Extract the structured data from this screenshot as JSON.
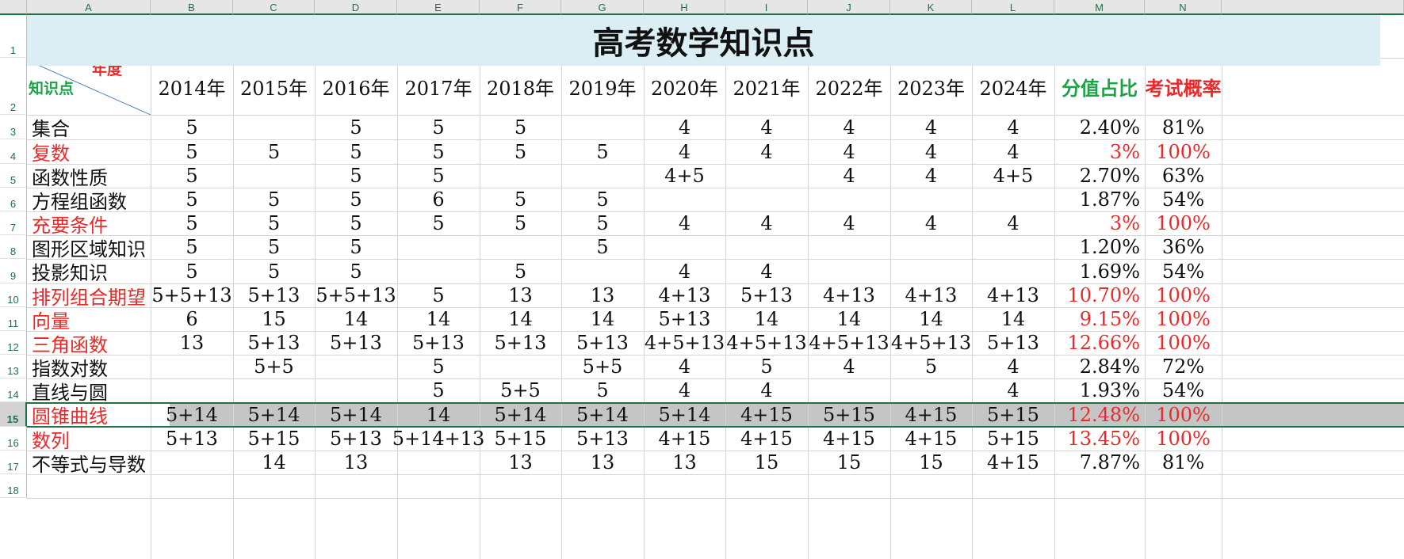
{
  "columns": [
    "A",
    "B",
    "C",
    "D",
    "E",
    "F",
    "G",
    "H",
    "I",
    "J",
    "K",
    "L",
    "M",
    "N"
  ],
  "title": "高考数学知识点",
  "corner": {
    "year_label": "年度",
    "topic_label": "知识点"
  },
  "years": [
    "2014年",
    "2015年",
    "2016年",
    "2017年",
    "2018年",
    "2019年",
    "2020年",
    "2021年",
    "2022年",
    "2023年",
    "2024年"
  ],
  "share_header": "分值占比",
  "prob_header": "考试概率",
  "row_numbers": [
    "1",
    "2",
    "3",
    "4",
    "5",
    "6",
    "7",
    "8",
    "9",
    "10",
    "11",
    "12",
    "13",
    "14",
    "15",
    "16",
    "17",
    "18"
  ],
  "rows": [
    {
      "topic": "集合",
      "red": false,
      "vals": [
        "5",
        "",
        "5",
        "5",
        "5",
        "",
        "4",
        "4",
        "4",
        "4",
        "4"
      ],
      "share": "2.40%",
      "prob": "81%"
    },
    {
      "topic": "复数",
      "red": true,
      "vals": [
        "5",
        "5",
        "5",
        "5",
        "5",
        "5",
        "4",
        "4",
        "4",
        "4",
        "4"
      ],
      "share": "3%",
      "prob": "100%"
    },
    {
      "topic": "函数性质",
      "red": false,
      "vals": [
        "5",
        "",
        "5",
        "5",
        "",
        "",
        "4+5",
        "",
        "4",
        "4",
        "4+5"
      ],
      "share": "2.70%",
      "prob": "63%"
    },
    {
      "topic": "方程组函数",
      "red": false,
      "vals": [
        "5",
        "5",
        "5",
        "6",
        "5",
        "5",
        "",
        "",
        "",
        "",
        ""
      ],
      "share": "1.87%",
      "prob": "54%"
    },
    {
      "topic": "充要条件",
      "red": true,
      "vals": [
        "5",
        "5",
        "5",
        "5",
        "5",
        "5",
        "4",
        "4",
        "4",
        "4",
        "4"
      ],
      "share": "3%",
      "prob": "100%"
    },
    {
      "topic": "图形区域知识",
      "red": false,
      "vals": [
        "5",
        "5",
        "5",
        "",
        "",
        "5",
        "",
        "",
        "",
        "",
        ""
      ],
      "share": "1.20%",
      "prob": "36%"
    },
    {
      "topic": "投影知识",
      "red": false,
      "vals": [
        "5",
        "5",
        "5",
        "",
        "5",
        "",
        "4",
        "4",
        "",
        "",
        ""
      ],
      "share": "1.69%",
      "prob": "54%"
    },
    {
      "topic": "排列组合期望",
      "red": true,
      "vals": [
        "5+5+13",
        "5+13",
        "5+5+13",
        "5",
        "13",
        "13",
        "4+13",
        "5+13",
        "4+13",
        "4+13",
        "4+13"
      ],
      "share": "10.70%",
      "prob": "100%"
    },
    {
      "topic": "向量",
      "red": true,
      "vals": [
        "6",
        "15",
        "14",
        "14",
        "14",
        "14",
        "5+13",
        "14",
        "14",
        "14",
        "14"
      ],
      "share": "9.15%",
      "prob": "100%"
    },
    {
      "topic": "三角函数",
      "red": true,
      "vals": [
        "13",
        "5+13",
        "5+13",
        "5+13",
        "5+13",
        "5+13",
        "4+5+13",
        "4+5+13",
        "4+5+13",
        "4+5+13",
        "5+13"
      ],
      "share": "12.66%",
      "prob": "100%"
    },
    {
      "topic": "指数对数",
      "red": false,
      "vals": [
        "",
        "5+5",
        "",
        "5",
        "",
        "5+5",
        "4",
        "5",
        "4",
        "5",
        "4"
      ],
      "share": "2.84%",
      "prob": "72%"
    },
    {
      "topic": "直线与圆",
      "red": false,
      "vals": [
        "",
        "",
        "",
        "5",
        "5+5",
        "5",
        "4",
        "4",
        "",
        "",
        "4"
      ],
      "share": "1.93%",
      "prob": "54%"
    },
    {
      "topic": "圆锥曲线",
      "red": true,
      "vals": [
        "5+14",
        "5+14",
        "5+14",
        "14",
        "5+14",
        "5+14",
        "5+14",
        "4+15",
        "5+15",
        "4+15",
        "5+15"
      ],
      "share": "12.48%",
      "prob": "100%"
    },
    {
      "topic": "数列",
      "red": true,
      "vals": [
        "5+13",
        "5+15",
        "5+13",
        "5+14+13",
        "5+15",
        "5+13",
        "4+15",
        "4+15",
        "4+15",
        "4+15",
        "5+15"
      ],
      "share": "13.45%",
      "prob": "100%"
    },
    {
      "topic": "不等式与导数",
      "red": false,
      "vals": [
        "",
        "14",
        "13",
        "",
        "13",
        "13",
        "13",
        "15",
        "15",
        "15",
        "4+15"
      ],
      "share": "7.87%",
      "prob": "81%"
    }
  ],
  "colors": {
    "header_green": "#1e7145",
    "title_bg": "#daeef3",
    "red": "#e82a2a",
    "green": "#1ba345",
    "selection": "#c5c5c5"
  }
}
